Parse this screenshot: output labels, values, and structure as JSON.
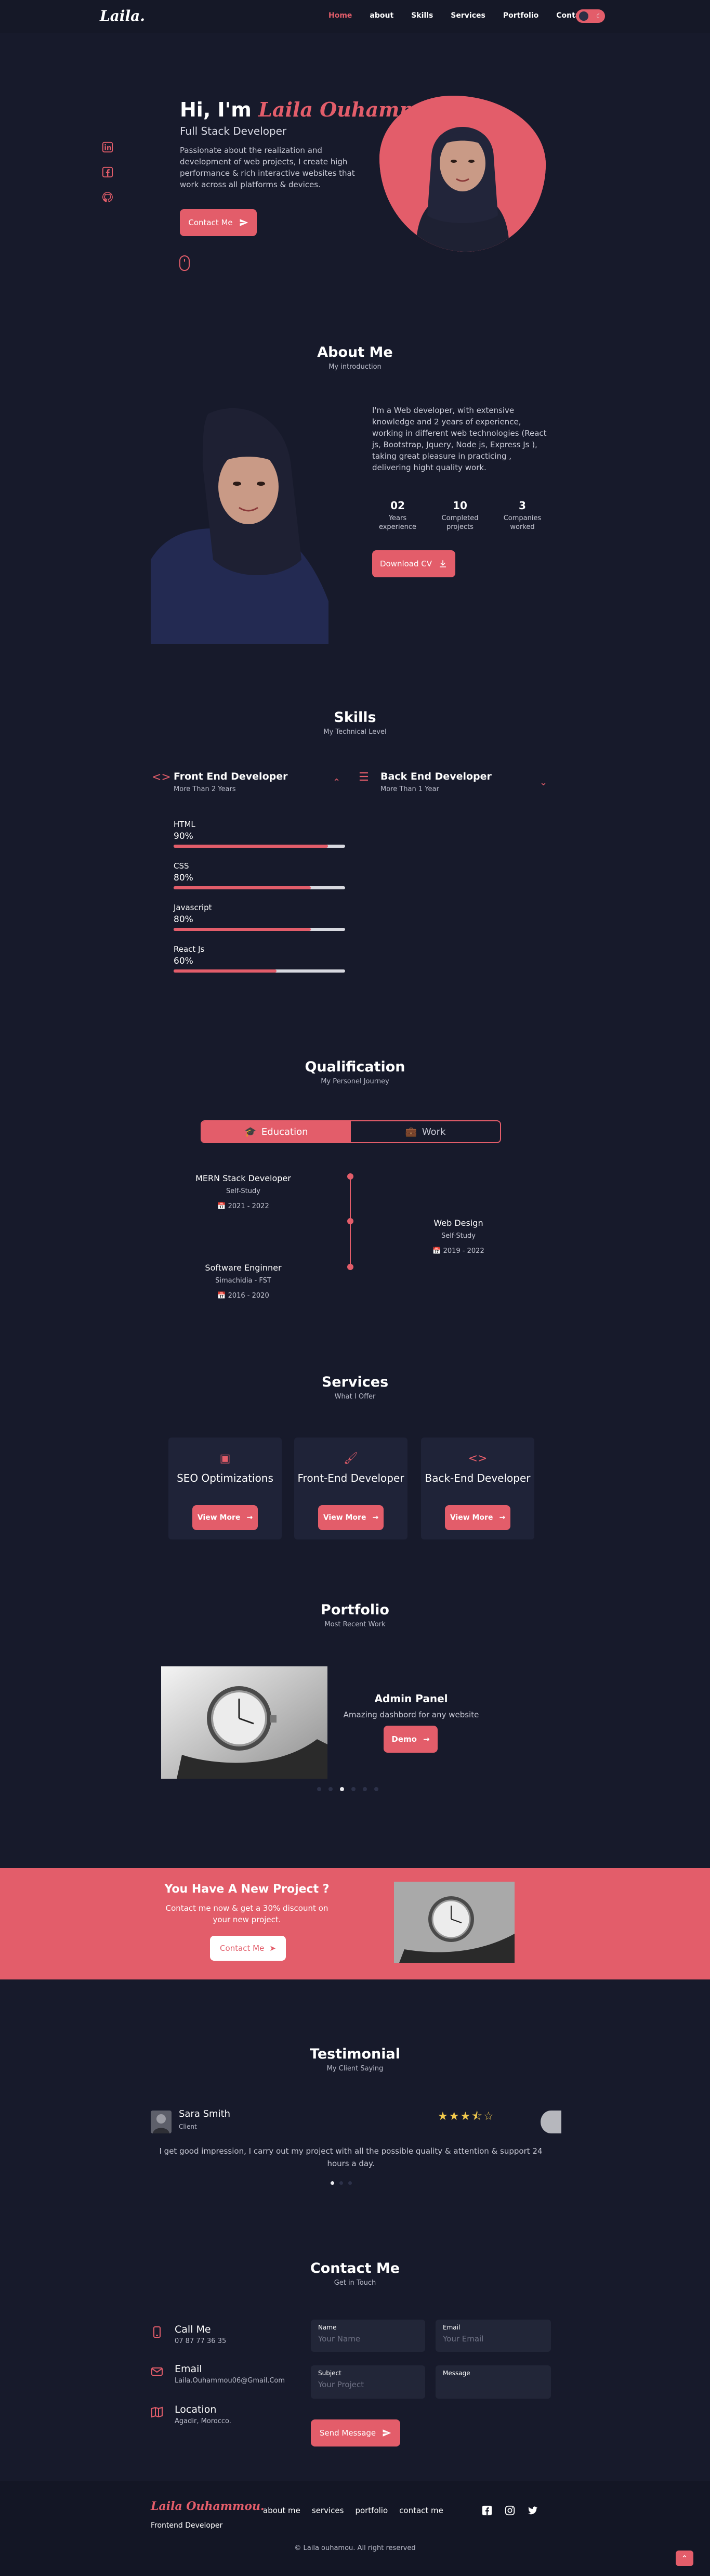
{
  "nav": {
    "logo": "Laila.",
    "links": [
      "Home",
      "about",
      "Skills",
      "Services",
      "Portfolio",
      "Contact me"
    ],
    "active_index": 0,
    "theme_toggle": {
      "left": "☀",
      "right": "☾"
    }
  },
  "hero": {
    "greeting": "Hi, I'm",
    "name": "Laila Ouhammou.",
    "role": "Full Stack Developer",
    "description": "Passionate about the realization and development of web projects, I create high performance & rich interactive websites that work across all platforms & devices.",
    "button": "Contact Me",
    "social_icons": [
      "linkedin-icon",
      "facebook-icon",
      "github-icon"
    ]
  },
  "about": {
    "title": "About Me",
    "subtitle": "My introduction",
    "text": "I'm a Web developer, with extensive knowledge and 2 years of experience, working in different web technologies (React js, Bootstrap, Jquery, Node js, Express Js ), taking great pleasure in practicing , delivering hight quality work.",
    "stats": [
      {
        "num": "02",
        "label": "Years experience"
      },
      {
        "num": "10",
        "label": "Completed projects"
      },
      {
        "num": "3",
        "label": "Companies worked"
      }
    ],
    "button": "Download CV"
  },
  "skills": {
    "title": "Skills",
    "subtitle": "My Technical Level",
    "front": {
      "title": "Front End Developer",
      "sub": "More Than 2 Years"
    },
    "back": {
      "title": "Back End Developer",
      "sub": "More Than 1 Year"
    },
    "items": [
      {
        "name": "HTML",
        "percent": "90%",
        "value": 90
      },
      {
        "name": "CSS",
        "percent": "80%",
        "value": 80
      },
      {
        "name": "Javascript",
        "percent": "80%",
        "value": 80
      },
      {
        "name": "React Js",
        "percent": "60%",
        "value": 60
      }
    ]
  },
  "qualification": {
    "title": "Qualification",
    "subtitle": "My Personel Journey",
    "tabs": [
      "Education",
      "Work"
    ],
    "items": [
      {
        "title": "MERN Stack Developer",
        "sub": "Self-Study",
        "date": "2021 - 2022"
      },
      {
        "title": "Web Design",
        "sub": "Self-Study",
        "date": "2019 - 2022"
      },
      {
        "title": "Software Enginner",
        "sub": "Simachidia - FST",
        "date": "2016 - 2020"
      }
    ]
  },
  "services": {
    "title": "Services",
    "subtitle": "What I Offer",
    "items": [
      {
        "title": "SEO Optimizations",
        "button": "View More"
      },
      {
        "title": "Front-End Developer",
        "button": "View More"
      },
      {
        "title": "Back-End Developer",
        "button": "View More"
      }
    ]
  },
  "portfolio": {
    "title": "Portfolio",
    "subtitle": "Most Recent Work",
    "project": {
      "title": "Admin Panel",
      "desc": "Amazing dashbord for any website",
      "button": "Demo"
    }
  },
  "promo": {
    "title": "You Have A New Project ?",
    "desc": "Contact me now & get a 30% discount on your new project.",
    "button": "Contact Me"
  },
  "testimonial": {
    "title": "Testimonial",
    "subtitle": "My Client Saying",
    "name": "Sara Smith",
    "role": "Client",
    "rating": 3.5,
    "stars": "★★★⯪☆",
    "text": "I get good impression, I carry out my project with all the possible quality & attention & support 24 hours a day."
  },
  "contact": {
    "title": "Contact Me",
    "subtitle": "Get in Touch",
    "info": [
      {
        "title": "Call Me",
        "value": "07 87 77 36 35"
      },
      {
        "title": "Email",
        "value": "Laila.Ouhammou06@Gmail.Com"
      },
      {
        "title": "Location",
        "value": "Agadir, Morocco."
      }
    ],
    "form": {
      "name_label": "Name",
      "name_placeholder": "Your Name",
      "email_label": "Email",
      "email_placeholder": "Your Email",
      "subject_label": "Subject",
      "subject_placeholder": "Your Project",
      "message_label": "Message",
      "message_placeholder": ""
    },
    "button": "Send Message"
  },
  "footer": {
    "name": "Laila Ouhammou.",
    "role": "Frontend Developer",
    "links": [
      "about me",
      "services",
      "portfolio",
      "contact me"
    ],
    "copyright": "© Laila ouhamou. All right reserved"
  },
  "colors": {
    "accent": "#e35d6a",
    "background": "#171a2b",
    "card": "#1f2338"
  }
}
